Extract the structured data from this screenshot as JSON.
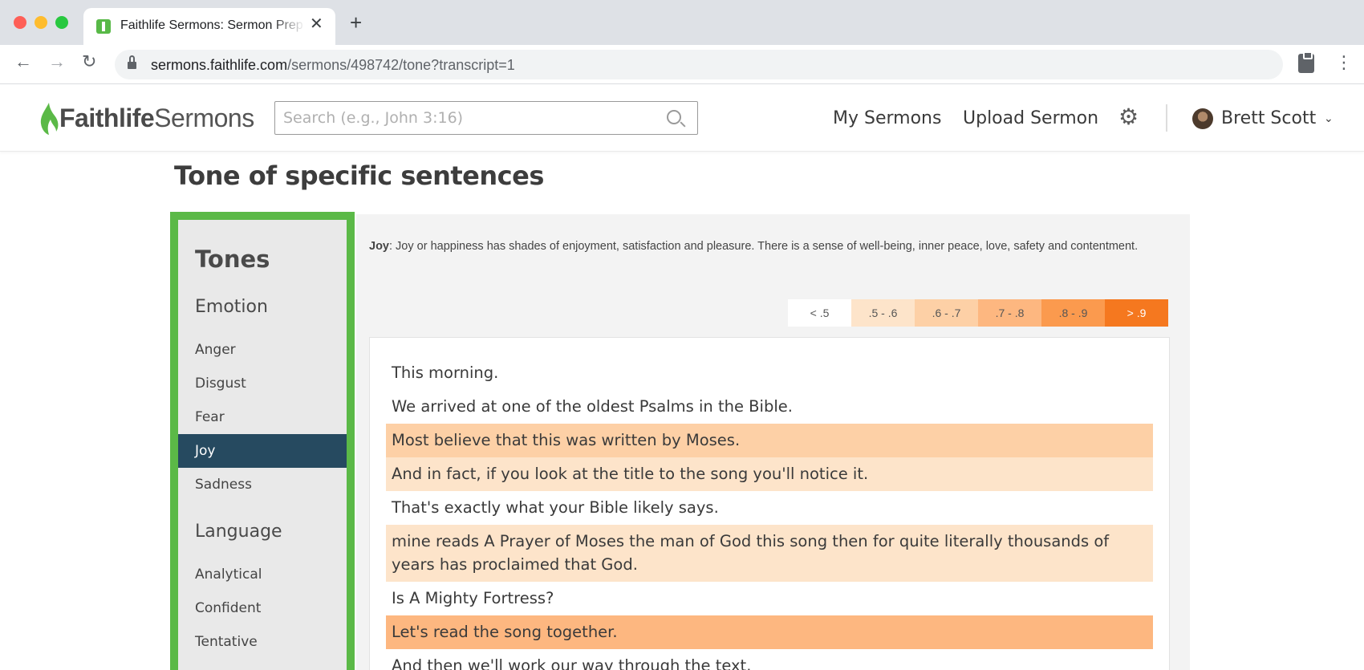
{
  "browser": {
    "tab_title": "Faithlife Sermons: Sermon Preparation",
    "url_host": "sermons.faithlife.com",
    "url_path": "/sermons/498742/tone?transcript=1"
  },
  "header": {
    "logo_bold": "Faithlife",
    "logo_light": "Sermons",
    "search_placeholder": "Search (e.g., John 3:16)",
    "nav_my_sermons": "My Sermons",
    "nav_upload": "Upload Sermon",
    "user_name": "Brett Scott"
  },
  "page": {
    "title": "Tone of specific sentences"
  },
  "tones": {
    "heading": "Tones",
    "emotion_label": "Emotion",
    "emotion_items": [
      "Anger",
      "Disgust",
      "Fear",
      "Joy",
      "Sadness"
    ],
    "language_label": "Language",
    "language_items": [
      "Analytical",
      "Confident",
      "Tentative"
    ],
    "selected": "Joy"
  },
  "description": {
    "term": "Joy",
    "text": ": Joy or happiness has shades of enjoyment, satisfaction and pleasure. There is a sense of well-being, inner peace, love, safety and contentment."
  },
  "legend": [
    {
      "label": "< .5",
      "color": "#ffffff"
    },
    {
      "label": ".5 - .6",
      "color": "#fde4ca"
    },
    {
      "label": ".6 - .7",
      "color": "#fdd0a6"
    },
    {
      "label": ".7 - .8",
      "color": "#fdb780"
    },
    {
      "label": ".8 - .9",
      "color": "#fb9a4e"
    },
    {
      "label": "> .9",
      "color": "#f5781f"
    }
  ],
  "transcript": [
    {
      "text": "This morning.",
      "band": 0
    },
    {
      "text": "We arrived at one of the oldest Psalms in the Bible.",
      "band": 0
    },
    {
      "text": "Most believe that this was written by Moses.",
      "band": 2
    },
    {
      "text": "And in fact, if you look at the title to the song you'll notice it.",
      "band": 1
    },
    {
      "text": "That's exactly what your Bible likely says.",
      "band": 0
    },
    {
      "text": "mine reads A Prayer of Moses the man of God this song then for quite literally thousands of years has proclaimed that God.",
      "band": 1
    },
    {
      "text": "Is A Mighty Fortress?",
      "band": 0
    },
    {
      "text": "Let's read the song together.",
      "band": 3
    },
    {
      "text": "And then we'll work our way through the text.",
      "band": 0
    }
  ]
}
